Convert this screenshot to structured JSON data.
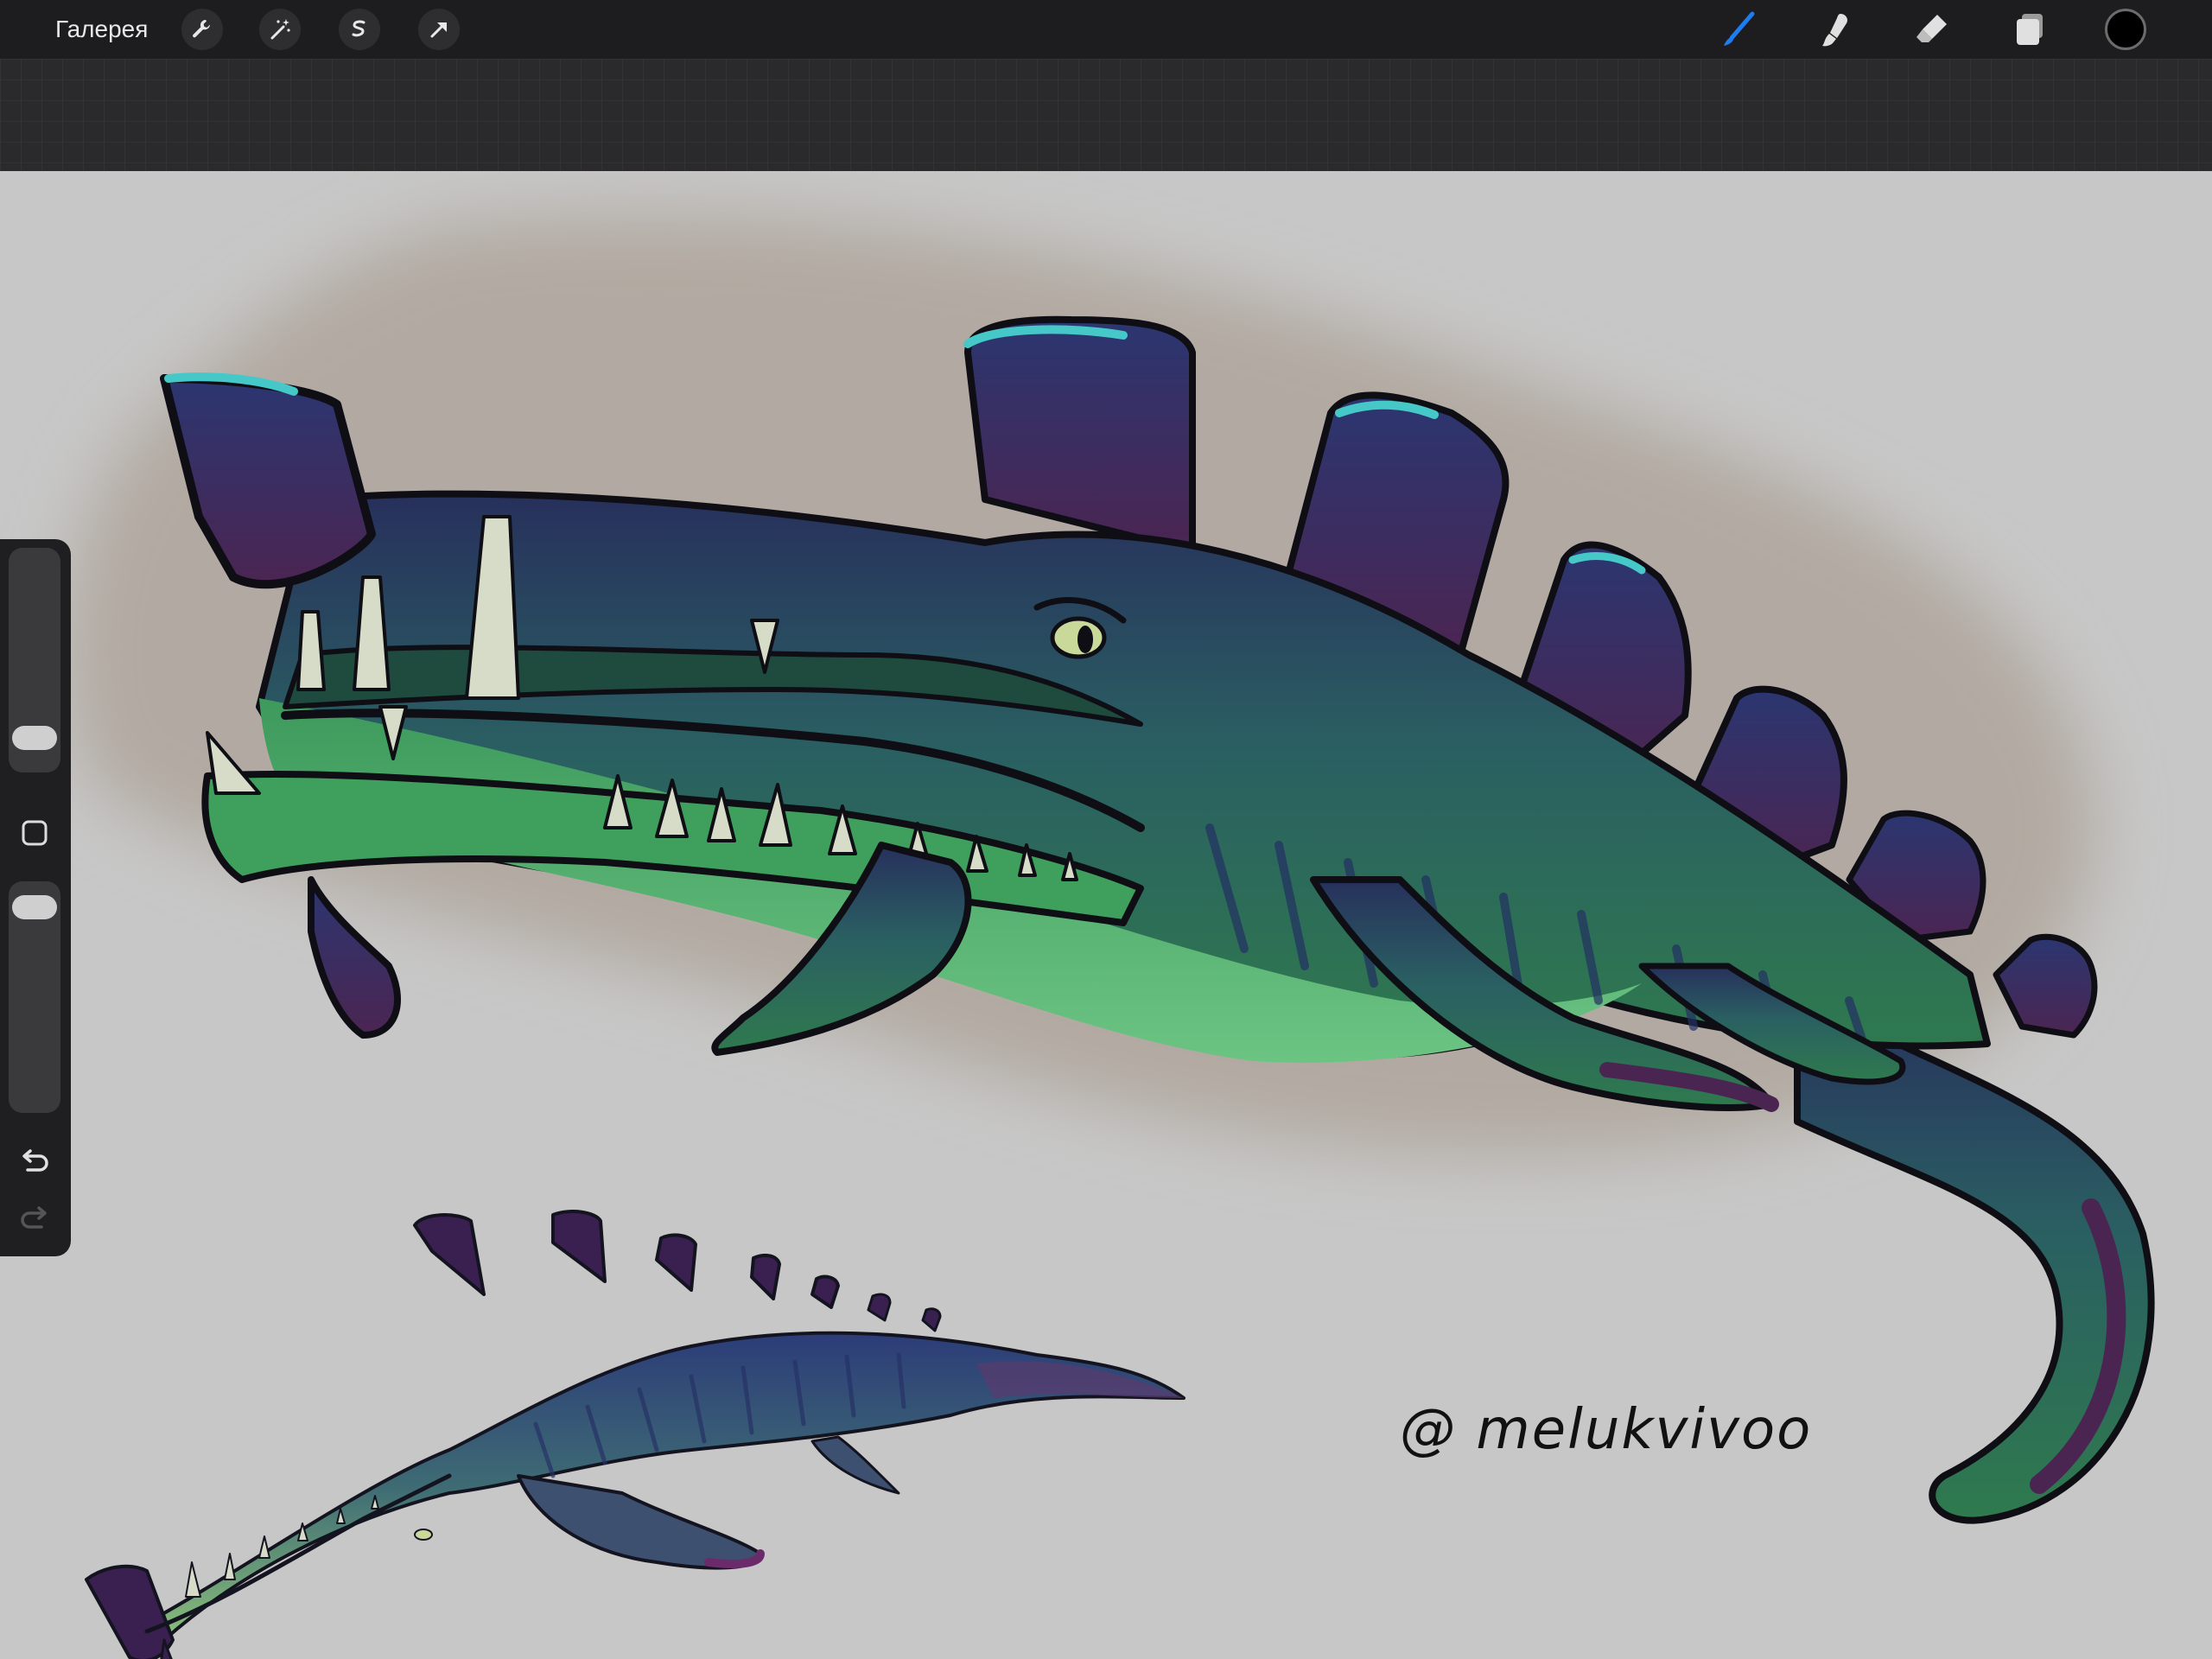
{
  "toolbar": {
    "gallery_label": "Галерея",
    "left_tools": [
      "wrench-icon",
      "magic-wand-icon",
      "selection-icon",
      "transform-arrow-icon"
    ],
    "right_tools": [
      "brush-icon",
      "smudge-icon",
      "eraser-icon",
      "layers-icon"
    ],
    "active_tool": "brush-icon",
    "accent_color": "#1e7cf2",
    "current_color": "#000000"
  },
  "sidebar": {
    "brush_size_level": 0.1,
    "opacity_level": 0.95,
    "modify_button": "square-icon",
    "undo": "undo-icon",
    "redo": "redo-icon"
  },
  "canvas": {
    "background_color": "#c7c7c7",
    "signature_text": "@ melukvivoo",
    "creature_colors": {
      "body_dark": "#27305c",
      "body_green": "#2f7a4e",
      "belly_green": "#6cc483",
      "fin_purple": "#3c2a55",
      "fin_highlight": "#46c8c8",
      "haze": "#b2aaa2"
    }
  }
}
